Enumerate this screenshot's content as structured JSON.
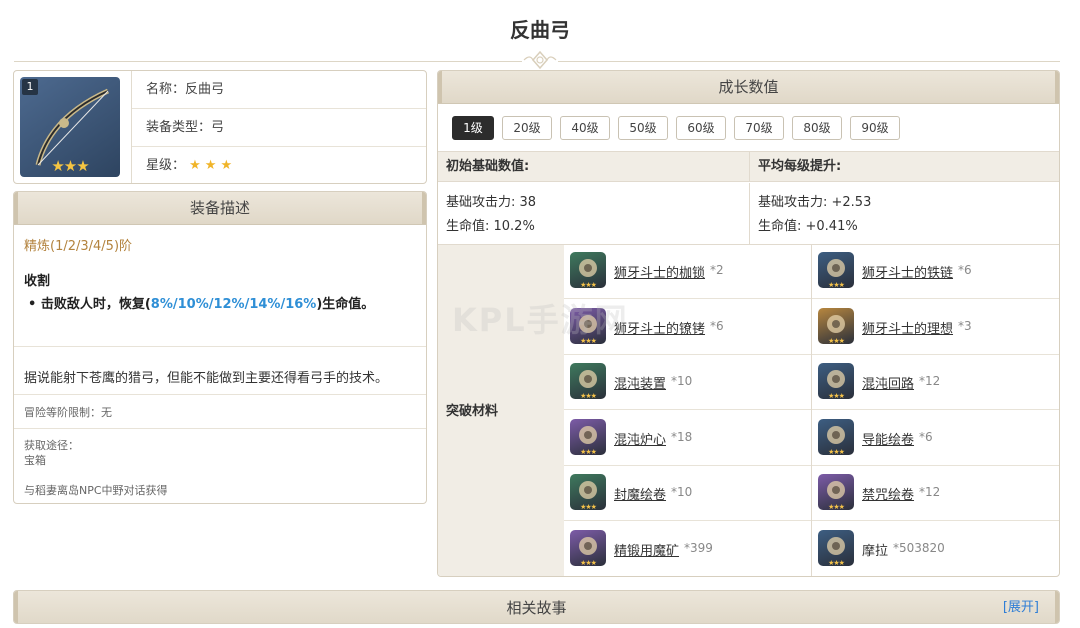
{
  "page": {
    "title": "反曲弓"
  },
  "info": {
    "level_badge": "1",
    "image_stars": "★★★",
    "name_row": "名称：反曲弓",
    "type_row": "装备类型：弓",
    "star_label": "星级：",
    "stars": "★★★"
  },
  "description": {
    "header": "装备描述",
    "refine": "精炼(1/2/3/4/5)阶",
    "skill_name": "收割",
    "skill_prefix": "• 击败敌人时，恢复(",
    "skill_values": "8%/10%/12%/14%/16%",
    "skill_suffix": ")生命值。",
    "flavor": "据说能射下苍鹰的猎弓，但能不能做到主要还得看弓手的技术。",
    "ar_limit": "冒险等阶限制：无",
    "source_label": "获取途径：",
    "source_1": "宝箱",
    "source_2": "与稻妻离岛NPC中野对话获得"
  },
  "growth": {
    "header": "成长数值",
    "levels": [
      "1级",
      "20级",
      "40级",
      "50级",
      "60级",
      "70级",
      "80级",
      "90级"
    ],
    "active_level": "1级",
    "base_head": "初始基础数值:",
    "per_level_head": "平均每级提升:",
    "base_atk": "基础攻击力: 38",
    "base_hp": "生命值: 10.2%",
    "inc_atk": "基础攻击力: +2.53",
    "inc_hp": "生命值: +0.41%",
    "materials_label": "突破材料",
    "materials": [
      {
        "name": "狮牙斗士的枷锁",
        "count": "*2",
        "icon": "chains-icon",
        "color": "#3f7a5e"
      },
      {
        "name": "狮牙斗士的铁链",
        "count": "*6",
        "icon": "iron-chain-icon",
        "color": "#3d5e82"
      },
      {
        "name": "狮牙斗士的镣铐",
        "count": "*6",
        "icon": "shackles-icon",
        "color": "#7d5ca8"
      },
      {
        "name": "狮牙斗士的理想",
        "count": "*3",
        "icon": "ideal-icon",
        "color": "#b8873f"
      },
      {
        "name": "混沌装置",
        "count": "*10",
        "icon": "chaos-device-icon",
        "color": "#3f7a5e"
      },
      {
        "name": "混沌回路",
        "count": "*12",
        "icon": "chaos-circuit-icon",
        "color": "#3d5e82"
      },
      {
        "name": "混沌炉心",
        "count": "*18",
        "icon": "chaos-core-icon",
        "color": "#7d5ca8"
      },
      {
        "name": "导能绘卷",
        "count": "*6",
        "icon": "scroll-icon",
        "color": "#3d5e82"
      },
      {
        "name": "封魔绘卷",
        "count": "*10",
        "icon": "sealed-scroll-icon",
        "color": "#3f7a5e"
      },
      {
        "name": "禁咒绘卷",
        "count": "*12",
        "icon": "forbidden-scroll-icon",
        "color": "#7d5ca8"
      },
      {
        "name": "精锻用魔矿",
        "count": "*399",
        "icon": "ore-icon",
        "color": "#7d5ca8"
      },
      {
        "name": "摩拉",
        "count": "*503820",
        "icon": "mora-icon",
        "color": "#3d5e82"
      }
    ]
  },
  "watermark": "KPL手游网",
  "story": {
    "header": "相关故事",
    "expand": "[展开]"
  }
}
